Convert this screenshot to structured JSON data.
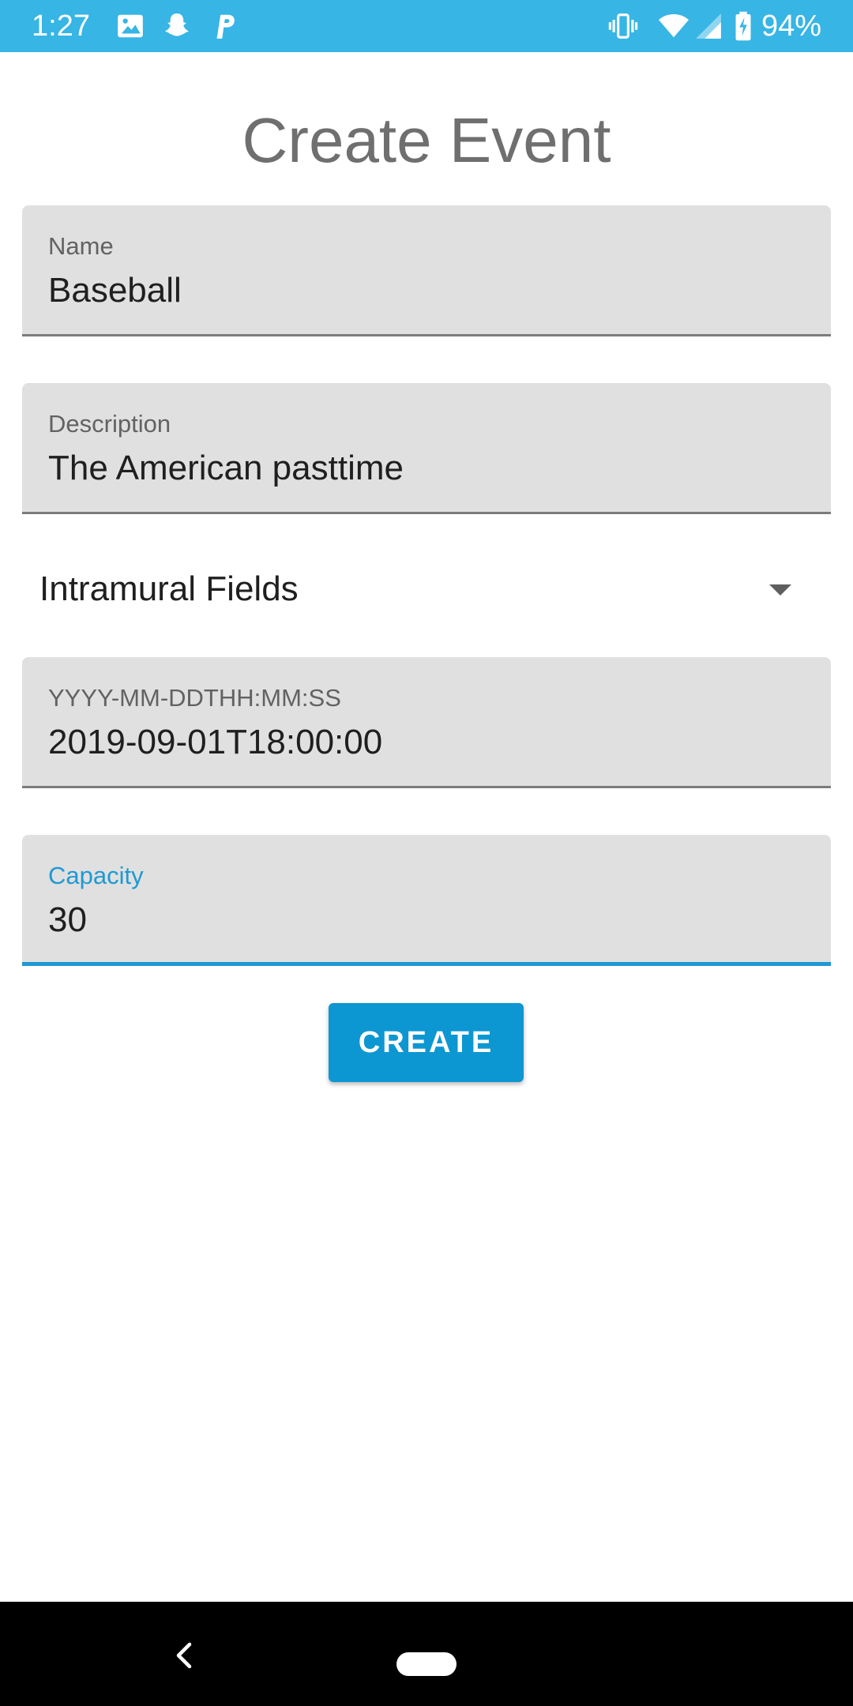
{
  "status_bar": {
    "time": "1:27",
    "battery_percent": "94%",
    "background_color": "#37b5e5",
    "left_icons": [
      "image-icon",
      "snapchat-icon",
      "parking-icon"
    ],
    "right_icons": [
      "vibrate-icon",
      "wifi-icon",
      "cell-signal-icon",
      "battery-charging-icon"
    ]
  },
  "page": {
    "title": "Create Event"
  },
  "form": {
    "name": {
      "label": "Name",
      "value": "Baseball"
    },
    "description": {
      "label": "Description",
      "value": "The American pasttime"
    },
    "location": {
      "selected": "Intramural Fields"
    },
    "datetime": {
      "label": "YYYY-MM-DDTHH:MM:SS",
      "value": "2019-09-01T18:00:00"
    },
    "capacity": {
      "label": "Capacity",
      "value": "30",
      "focused": true
    },
    "submit_label": "CREATE"
  },
  "colors": {
    "accent": "#0d97d2",
    "field_background": "#e0e0e0",
    "title_text": "#6f6f6f"
  },
  "nav_bar": {
    "icons": [
      "back-icon",
      "home-pill-icon"
    ]
  }
}
